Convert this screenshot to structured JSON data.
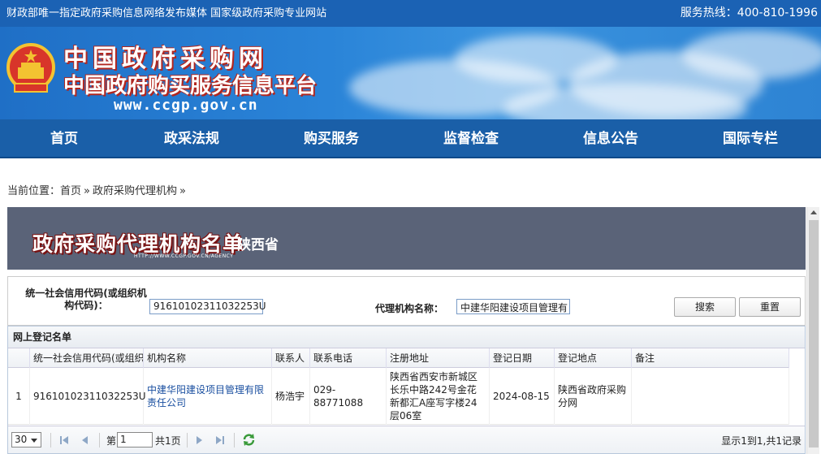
{
  "topbar": {
    "slogan": "财政部唯一指定政府采购信息网络发布媒体 国家级政府采购专业网站",
    "hotline": "服务热线：400-810-1996"
  },
  "header": {
    "title": "中国政府采购网",
    "subtitle": "中国政府购买服务信息平台",
    "url": "www.ccgp.gov.cn"
  },
  "nav": {
    "items": [
      "首页",
      "政采法规",
      "购买服务",
      "监督检查",
      "信息公告",
      "国际专栏"
    ]
  },
  "breadcrumb": {
    "prefix": "当前位置：",
    "home": "首页",
    "sep": "»",
    "current": "政府采购代理机构",
    "tail": "»"
  },
  "banner": {
    "title": "政府采购代理机构名单",
    "province": "陕西省",
    "url": "HTTP://WWW.CCGP.GOV.CN/AGENCY"
  },
  "search": {
    "code_label": "统一社会信用代码(或组织机构代码)：",
    "code_value": "91610102311032253U",
    "name_label": "代理机构名称：",
    "name_value": "中建华阳建设项目管理有",
    "search_button": "搜索",
    "reset_button": "重置"
  },
  "grid": {
    "title": "网上登记名单",
    "columns": [
      "统一社会信用代码(或组织",
      "机构名称",
      "联系人",
      "联系电话",
      "注册地址",
      "登记日期",
      "登记地点",
      "备注"
    ],
    "rows": [
      {
        "index": "1",
        "code": "91610102311032253U",
        "name": "中建华阳建设项目管理有限责任公司",
        "contact": "杨浩宇",
        "phone": "029-88771088",
        "address": "陕西省西安市新城区长乐中路242号金花新都汇A座写字楼24层06室",
        "date": "2024-08-15",
        "location": "陕西省政府采购分网",
        "remark": ""
      }
    ]
  },
  "pager": {
    "page_size": "30",
    "page_prefix": "第",
    "page_value": "1",
    "page_total": "共1页",
    "info": "显示1到1,共1记录"
  },
  "colors": {
    "topbar": "#1b62b4",
    "nav": "#1a5fa8",
    "banner": "#5a6378",
    "link": "#1a4fa0"
  }
}
